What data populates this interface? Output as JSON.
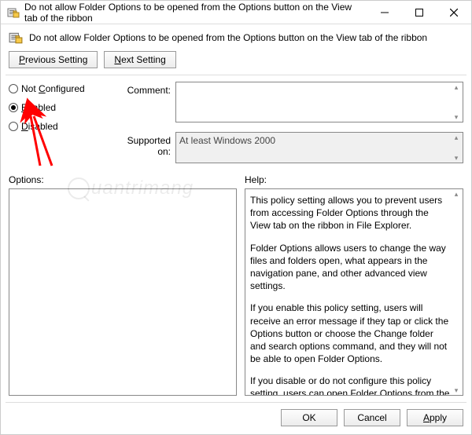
{
  "titlebar": {
    "title": "Do not allow Folder Options to be opened from the Options button on the View tab of the ribbon"
  },
  "header": {
    "title": "Do not allow Folder Options to be opened from the Options button on the View tab of the ribbon"
  },
  "nav": {
    "prev_prefix": "P",
    "prev_rest": "revious Setting",
    "next_prefix": "N",
    "next_rest": "ext Setting"
  },
  "radios": {
    "not_configured_ul": "C",
    "not_configured_pre": "Not ",
    "not_configured_post": "onfigured",
    "enabled_ul": "E",
    "enabled_rest": "nabled",
    "disabled_ul": "D",
    "disabled_rest": "isabled",
    "selected": "enabled"
  },
  "labels": {
    "comment": "Comment:",
    "supported": "Supported on:",
    "options": "Options:",
    "help": "Help:"
  },
  "supported_text": "At least Windows 2000",
  "help": {
    "p1": "This policy setting allows you to prevent users from accessing Folder Options through the View tab on the ribbon in File Explorer.",
    "p2": "Folder Options allows users to change the way files and folders open, what appears in the navigation pane, and other advanced view settings.",
    "p3": "If you enable this policy setting, users will receive an error message if they tap or click the Options button or choose the Change folder and search options command, and they will not be able to open Folder Options.",
    "p4": "If you disable or do not configure this policy setting, users can open Folder Options from the View tab on the ribbon."
  },
  "footer": {
    "ok": "OK",
    "cancel": "Cancel",
    "apply_ul": "A",
    "apply_rest": "pply"
  },
  "watermark": "uantrimang"
}
